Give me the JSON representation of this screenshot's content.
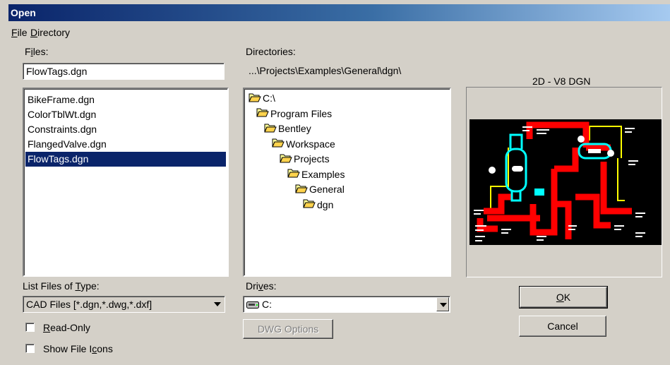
{
  "window": {
    "title": "Open"
  },
  "menu": {
    "file": {
      "label": "File",
      "mnemonic": "F",
      "rest": "ile"
    },
    "directory": {
      "label": "Directory",
      "mnemonic": "D",
      "rest": "irectory"
    }
  },
  "files": {
    "label_pre": "F",
    "label_mn": "i",
    "label_post": "les:",
    "filename_value": "FlowTags.dgn",
    "list": [
      "BikeFrame.dgn",
      "ColorTblWt.dgn",
      "Constraints.dgn",
      "FlangedValve.dgn",
      "FlowTags.dgn"
    ],
    "selected_index": 4
  },
  "directories": {
    "label": "Directories:",
    "current_path": "...\\Projects\\Examples\\General\\dgn\\",
    "tree": [
      {
        "label": "C:\\",
        "depth": 0,
        "open": true
      },
      {
        "label": "Program Files",
        "depth": 1,
        "open": true
      },
      {
        "label": "Bentley",
        "depth": 2,
        "open": true
      },
      {
        "label": "Workspace",
        "depth": 3,
        "open": true
      },
      {
        "label": "Projects",
        "depth": 4,
        "open": true
      },
      {
        "label": "Examples",
        "depth": 5,
        "open": true
      },
      {
        "label": "General",
        "depth": 6,
        "open": true
      },
      {
        "label": "dgn",
        "depth": 7,
        "open": true,
        "selected": true
      }
    ]
  },
  "preview": {
    "format_label": "2D - V8 DGN"
  },
  "file_type": {
    "label_pre": "List Files of ",
    "label_mn": "T",
    "label_post": "ype:",
    "value": "CAD Files [*.dgn,*.dwg,*.dxf]"
  },
  "drives": {
    "label_pre": "Dri",
    "label_mn": "v",
    "label_post": "es:",
    "value": "C:",
    "icon": "drive-icon"
  },
  "buttons": {
    "dwg_options": "DWG Options",
    "ok_mn": "O",
    "ok_post": "K",
    "cancel": "Cancel"
  },
  "checkboxes": {
    "read_only": {
      "mn": "R",
      "post": "ead-Only",
      "checked": false
    },
    "show_icons": {
      "pre": "Show File I",
      "mn": "c",
      "post": "ons",
      "checked": false
    }
  },
  "colors": {
    "title_start": "#0a246a",
    "selection": "#0a246a",
    "face": "#d4d0c8",
    "pipe_red": "#ff0000",
    "vessel_cyan": "#00ffff",
    "line_yellow": "#ffff00"
  }
}
